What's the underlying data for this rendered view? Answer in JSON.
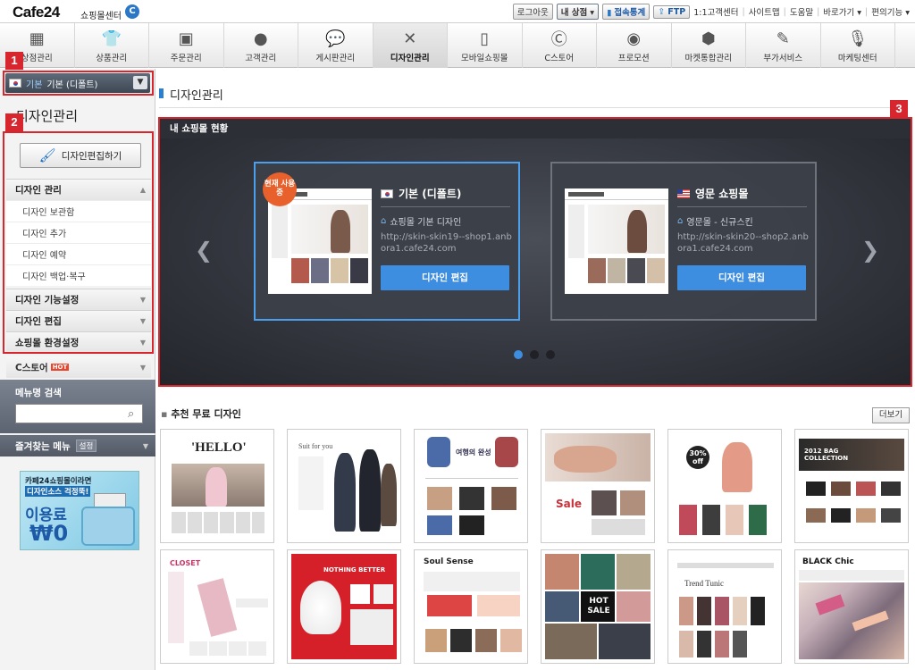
{
  "topbar": {
    "logo": "Cafe24",
    "logo_sub": "쇼핑몰센터",
    "logo_badge": "C",
    "logout": "로그아웃",
    "my_shop": "내 상점",
    "stats": "접속통계",
    "ftp": "FTP",
    "links": [
      "1:1고객센터",
      "사이트맵",
      "도움말",
      "바로가기 ▾",
      "편의기능 ▾"
    ]
  },
  "nav": {
    "items": [
      {
        "label": "상점관리",
        "icon": "store-icon"
      },
      {
        "label": "상품관리",
        "icon": "shirt-icon"
      },
      {
        "label": "주문관리",
        "icon": "box-icon"
      },
      {
        "label": "고객관리",
        "icon": "person-icon"
      },
      {
        "label": "게시판관리",
        "icon": "speech-icon"
      },
      {
        "label": "디자인관리",
        "icon": "brush-ruler-icon",
        "active": true
      },
      {
        "label": "모바일쇼핑몰",
        "icon": "mobile-icon"
      },
      {
        "label": "C스토어",
        "icon": "cstore-icon"
      },
      {
        "label": "프로모션",
        "icon": "promotion-icon"
      },
      {
        "label": "마켓통합관리",
        "icon": "market-icon"
      },
      {
        "label": "부가서비스",
        "icon": "pencil-icon"
      },
      {
        "label": "마케팅센터",
        "icon": "mic-icon"
      }
    ]
  },
  "badges": {
    "b1": "1",
    "b2": "2",
    "b3": "3"
  },
  "sidebar": {
    "shop_tag": "기본",
    "shop_name": "기본 (디폴트)",
    "title": "디자인관리",
    "edit_button": "디자인편집하기",
    "section_design": "디자인 관리",
    "sub_items": [
      "디자인 보관함",
      "디자인 추가",
      "디자인 예약",
      "디자인 백업·복구"
    ],
    "section_feature": "디자인 기능설정",
    "section_edit": "디자인 편집",
    "section_env": "쇼핑몰 환경설정",
    "cstore": "C스토어",
    "hot": "HOT",
    "menu_search_label": "메뉴명 검색",
    "menu_search_placeholder": "",
    "favorites": "즐겨찾는 메뉴",
    "fav_setting": "설정",
    "ad_line1": "카페24쇼핑몰이라면",
    "ad_line2": "디자인소스 걱정뚝!",
    "ad_line3": "이용료",
    "ad_line4": "₩0"
  },
  "main": {
    "page_title": "디자인관리",
    "status_title": "내 쇼핑몰 현황",
    "cards": [
      {
        "badge": "현재 사용중",
        "title": "기본 (디폴트)",
        "desc": "쇼핑몰 기본 디자인",
        "url": "http://skin-skin19--shop1.anbora1.cafe24.com",
        "button": "디자인 편집"
      },
      {
        "title": "영문 쇼핑몰",
        "desc": "영문몰 - 신규스킨",
        "url": "http://skin-skin20--shop2.anbora1.cafe24.com",
        "button": "디자인 편집"
      }
    ],
    "recommend_title": "추천 무료 디자인",
    "more_button": "더보기",
    "tiles": [
      {
        "text": "'HELLO'"
      },
      {
        "text": "Suit for you"
      },
      {
        "text": "여행의 완성"
      },
      {
        "text": "Sale"
      },
      {
        "text": "30% off"
      },
      {
        "text": "2012 BAG COLLECTION"
      },
      {
        "text": "CLOSET"
      },
      {
        "text": "NOTHING BETTER"
      },
      {
        "text": "Soul Sense"
      },
      {
        "text": "HOT SALE"
      },
      {
        "text": "Trend Tunic"
      },
      {
        "text": "BLACK Chic"
      }
    ]
  },
  "colors": {
    "accent": "#3d8de0",
    "highlight": "#d8262f",
    "nav_active": "#d5d5d5"
  }
}
